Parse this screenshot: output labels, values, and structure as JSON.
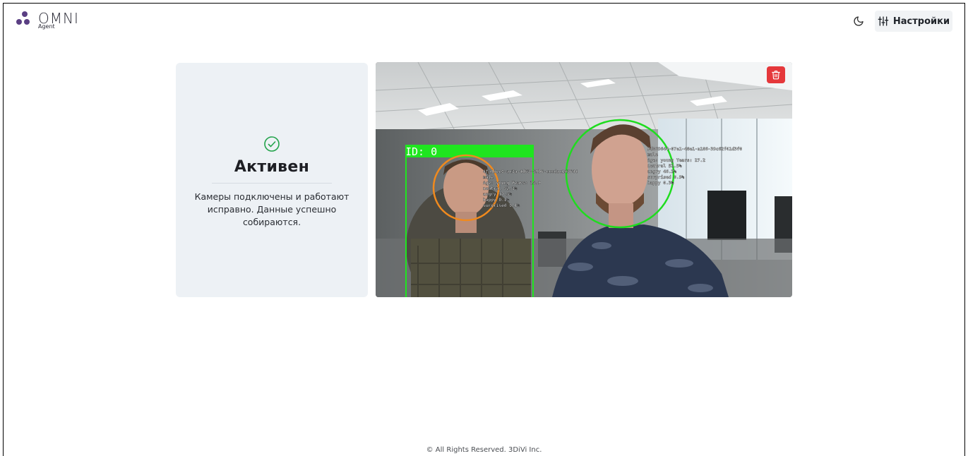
{
  "header": {
    "logo_title": "OMNI",
    "logo_subtitle": "Agent",
    "settings_label": "Настройки",
    "theme_icon": "moon-icon",
    "settings_icon": "sliders-icon"
  },
  "status": {
    "icon": "check-circle-icon",
    "title": "Активен",
    "description": "Камеры подключены и работают исправно. Данные успешно собираются.",
    "accent_color": "#22a34a"
  },
  "camera": {
    "track_id_label": "ID: 0",
    "delete_icon": "trash-icon",
    "delete_color": "#e5383b",
    "faces": [
      {
        "lines": [
          "4fa9bee0-ac3a-4d63-89b6-cccdac143644",
          "male",
          "Age: young Years: 28.9",
          "neutral   82.3%",
          "angry     17.5%",
          "happy     0.1%",
          "surprised 0.1%"
        ],
        "circle_color": "#f08a1e"
      },
      {
        "lines": [
          "9d069644-07e1-48e1-a186-39c62f41d3f0",
          "male",
          "Age: young Years: 27.2",
          "neutral   52.5%",
          "angry     46.2%",
          "surprised 0.9%",
          "happy     0.3%"
        ],
        "circle_color": "#1fdc1f"
      }
    ]
  },
  "footer": {
    "text": "© All Rights Reserved. 3DiVi Inc."
  }
}
